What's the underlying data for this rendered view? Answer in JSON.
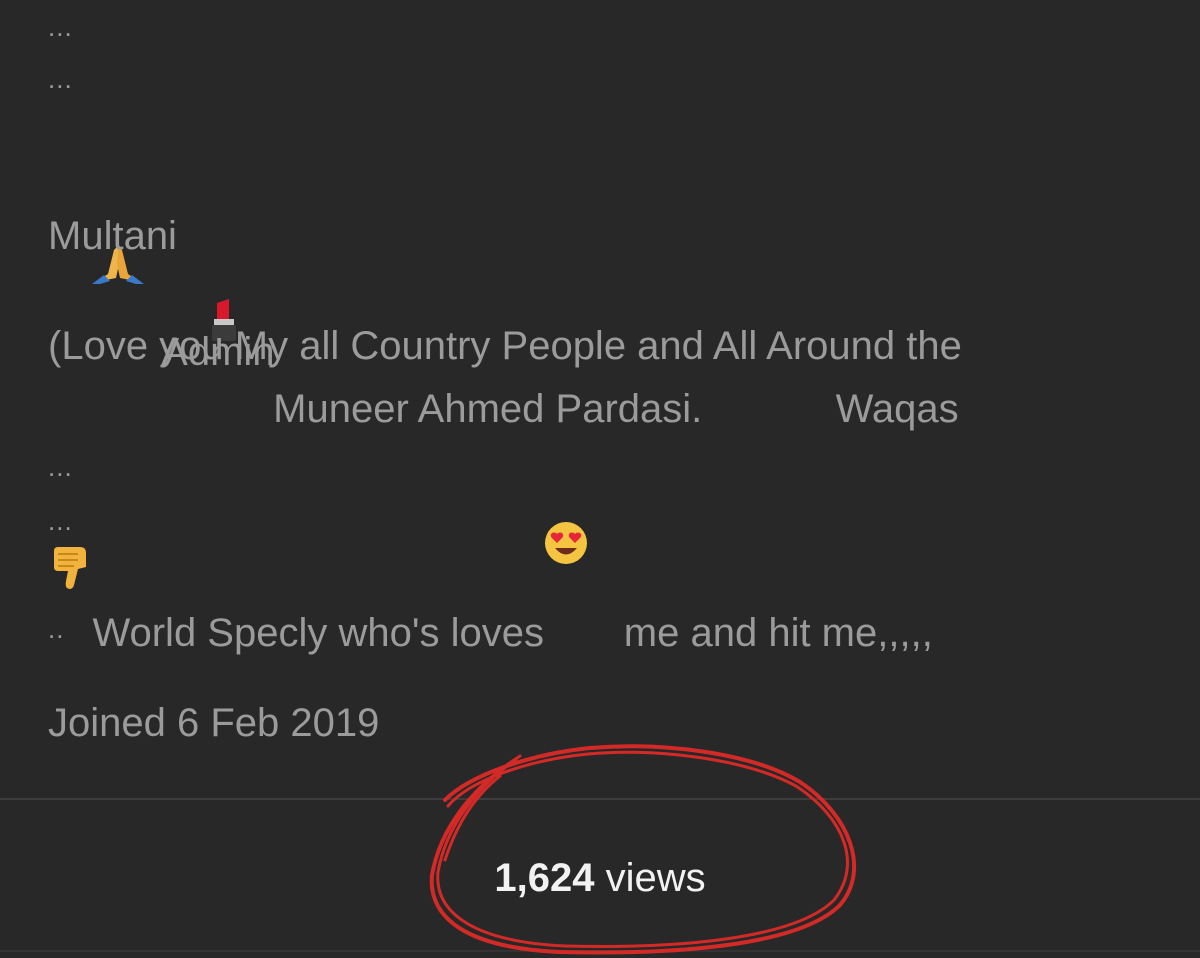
{
  "bio": {
    "dots_top_1": "...",
    "dots_top_2": "...",
    "admin_label": "Admin",
    "admin_names": "Muneer Ahmed Pardasi.            Waqas",
    "admin_names_cont": "Multani",
    "message_line_1": "(Love you My all Country People and All Around the",
    "message_line_2_a": "World Specly who's loves",
    "message_line_2_b": " me and hit me,,,,,",
    "dots_mid_1": "...",
    "dots_mid_2": "...",
    "dots_low": "..",
    "icons": [
      "folded-hands-emoji",
      "lipstick-emoji",
      "heart-eyes-emoji",
      "thumbs-down-emoji"
    ]
  },
  "profile": {
    "joined": "Joined 6 Feb 2019"
  },
  "stats": {
    "views_count": "1,624",
    "views_label": " views"
  },
  "colors": {
    "background": "#282828",
    "text": "#9b9b9b",
    "highlight_text": "#f2f2f2",
    "annotation_circle": "#d42a27"
  }
}
